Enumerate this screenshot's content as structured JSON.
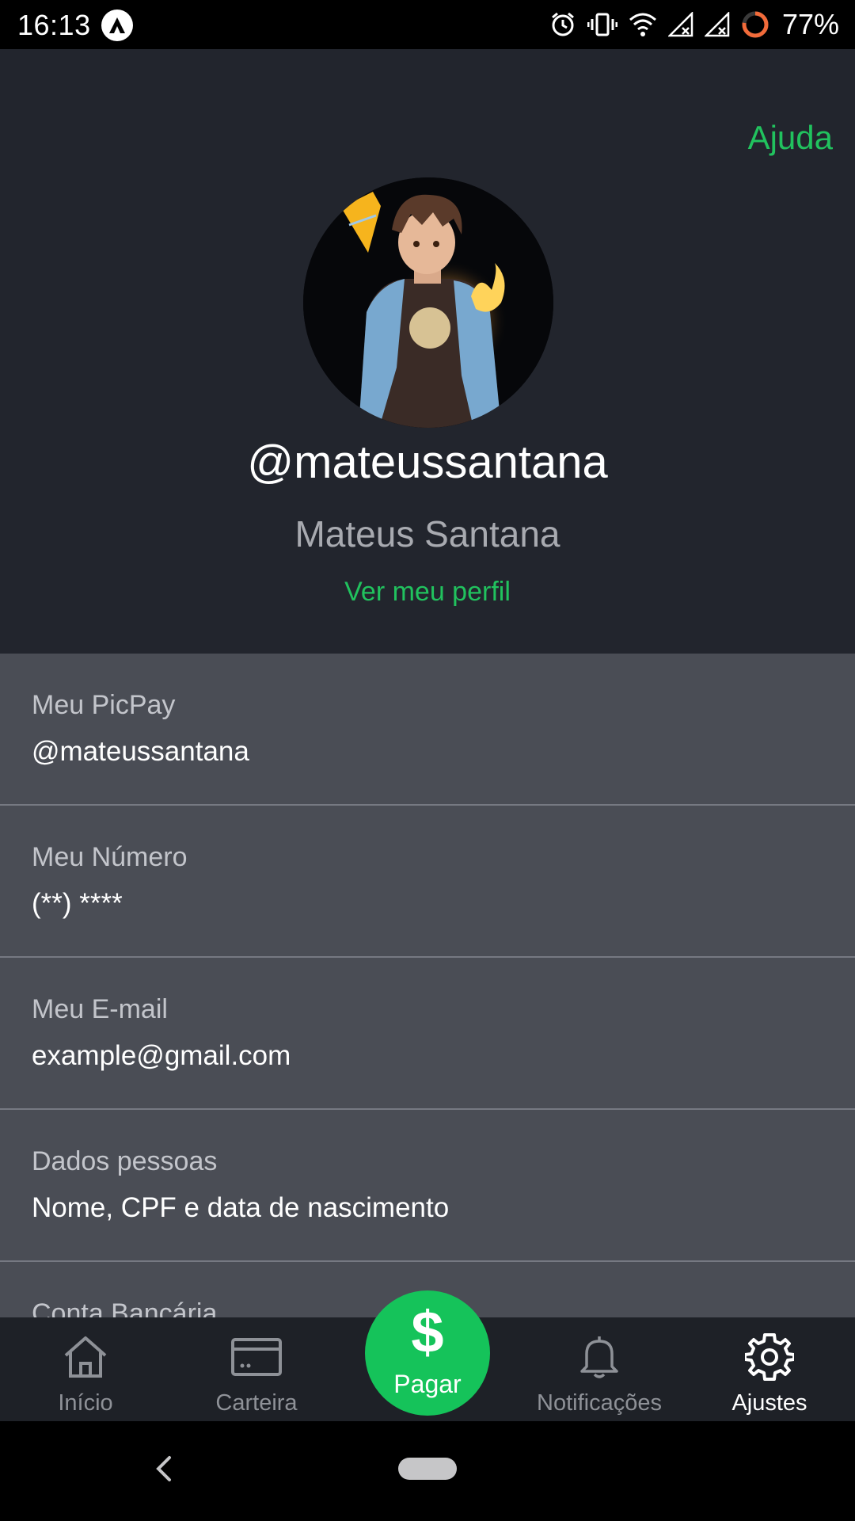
{
  "status_bar": {
    "time": "16:13",
    "battery": "77%",
    "icons": [
      "app-icon",
      "alarm-icon",
      "vibrate-icon",
      "wifi-icon",
      "signal-icon",
      "signal-icon",
      "battery-ring-icon"
    ]
  },
  "header": {
    "help": "Ajuda",
    "username": "@mateussantana",
    "full_name": "Mateus Santana",
    "profile_link": "Ver meu perfil"
  },
  "settings": [
    {
      "title": "Meu PicPay",
      "value": "@mateussantana"
    },
    {
      "title": "Meu Número",
      "value": "(**) ****"
    },
    {
      "title": "Meu E-mail",
      "value": "example@gmail.com"
    },
    {
      "title": "Dados pessoas",
      "value": "Nome, CPF e data de nascimento"
    },
    {
      "title": "Conta Bancária",
      "value": ""
    }
  ],
  "bottom_nav": {
    "home": "Início",
    "wallet": "Carteira",
    "pay": "Pagar",
    "pay_symbol": "$",
    "notifications": "Notificações",
    "settings": "Ajustes",
    "active": "settings"
  },
  "colors": {
    "accent_green": "#21c25e",
    "header_bg": "#22252d",
    "list_bg": "#4a4d55",
    "nav_bg": "#1e2127"
  }
}
